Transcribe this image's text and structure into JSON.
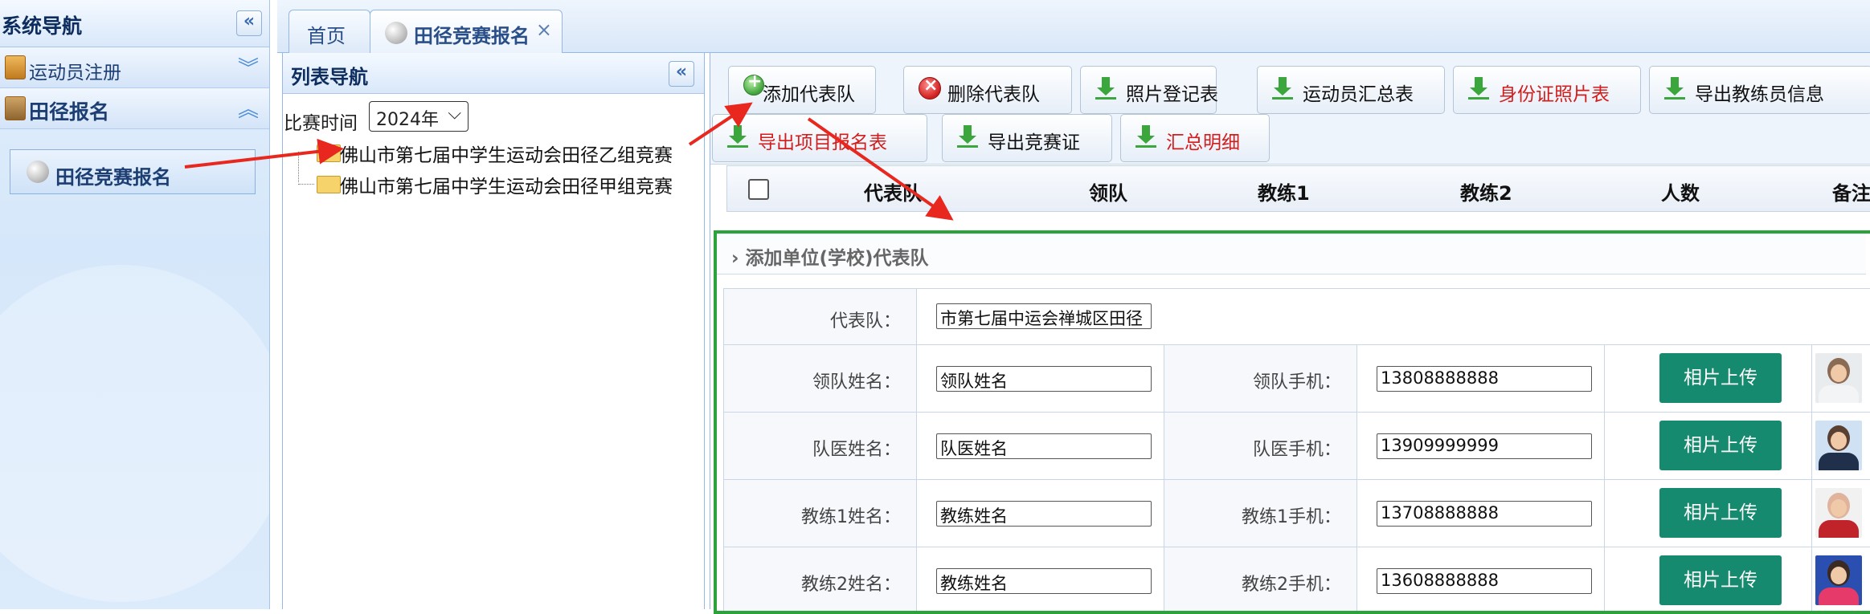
{
  "system_nav": {
    "title": "系统导航",
    "collapse_icon": "double-chevron-left-icon",
    "groups": [
      {
        "label": "运动员注册",
        "expanded": false
      },
      {
        "label": "田径报名",
        "expanded": true
      }
    ],
    "active_item": "田径竞赛报名"
  },
  "tabs": [
    {
      "label": "首页"
    },
    {
      "label": "田径竞赛报名",
      "active": true
    }
  ],
  "list_nav": {
    "title": "列表导航",
    "year_label": "比赛时间",
    "year_value": "2024年",
    "tree": [
      "佛山市第七届中学生运动会田径乙组竞赛",
      "佛山市第七届中学生运动会田径甲组竞赛"
    ]
  },
  "toolbar": {
    "buttons": [
      {
        "label": "添加代表队",
        "icon": "add-icon"
      },
      {
        "label": "删除代表队",
        "icon": "delete-icon"
      },
      {
        "label": "照片登记表",
        "icon": "download-icon"
      },
      {
        "label": "运动员汇总表",
        "icon": "download-icon"
      },
      {
        "label": "身份证照片表",
        "icon": "download-icon",
        "color": "#d21d1d"
      },
      {
        "label": "导出教练员信息",
        "icon": "download-icon"
      },
      {
        "label": "导出项目报名表",
        "icon": "download-icon",
        "color": "#d21d1d"
      },
      {
        "label": "导出竞赛证",
        "icon": "download-icon"
      },
      {
        "label": "汇总明细",
        "icon": "download-icon",
        "color": "#d21d1d"
      }
    ]
  },
  "grid": {
    "columns": [
      "代表队",
      "领队",
      "教练1",
      "教练2",
      "人数",
      "备注"
    ]
  },
  "add_form": {
    "title": "添加单位(学校)代表队",
    "team_label": "代表队：",
    "team_value": "市第七届中运会禅城区田径",
    "upload_label": "相片上传",
    "rows": [
      {
        "name_label": "领队姓名：",
        "name_value": "领队姓名",
        "phone_label": "领队手机：",
        "phone_value": "13808888888"
      },
      {
        "name_label": "队医姓名：",
        "name_value": "队医姓名",
        "phone_label": "队医手机：",
        "phone_value": "13909999999"
      },
      {
        "name_label": "教练1姓名：",
        "name_value": "教练姓名",
        "phone_label": "教练1手机：",
        "phone_value": "13708888888"
      },
      {
        "name_label": "教练2姓名：",
        "name_value": "教练姓名",
        "phone_label": "教练2手机：",
        "phone_value": "13608888888"
      }
    ]
  },
  "colors": {
    "accent": "#168a6e",
    "highlight_border": "#2aa43a",
    "annotation_arrow": "#e8271f",
    "red_text": "#d21d1d",
    "nav_title": "#0e2d5f"
  }
}
